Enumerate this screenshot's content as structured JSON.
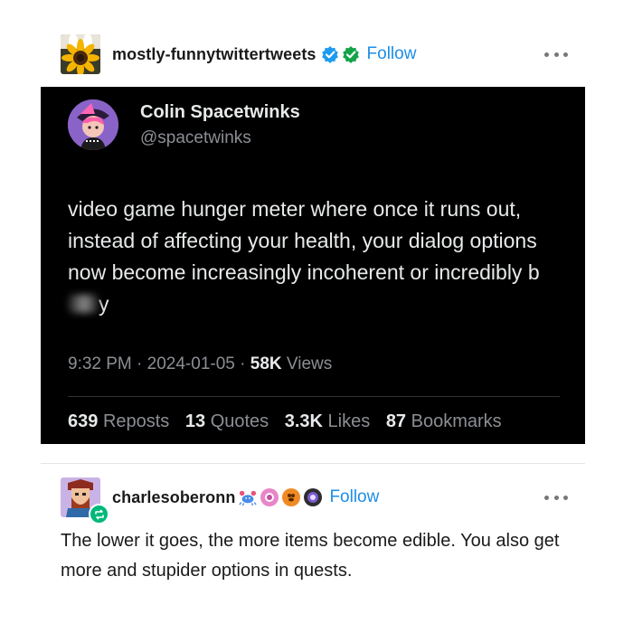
{
  "post1": {
    "username": "mostly-funnytwittertweets",
    "follow_label": "Follow",
    "avatar_icon": "sunflower-avatar-icon",
    "badges": [
      "blue-verified-icon",
      "green-verified-icon"
    ]
  },
  "tweet": {
    "display_name": "Colin Spacetwinks",
    "handle": "@spacetwinks",
    "text_main": "video game hunger meter where once it runs out, instead of affecting your health, your dialog options now become increasingly incoherent or incredibly b",
    "text_tail": "y",
    "time": "9:32 PM",
    "date": "2024-01-05",
    "views_count": "58K",
    "views_label": "Views",
    "reposts_count": "639",
    "reposts_label": "Reposts",
    "quotes_count": "13",
    "quotes_label": "Quotes",
    "likes_count": "3.3K",
    "likes_label": "Likes",
    "bookmarks_count": "87",
    "bookmarks_label": "Bookmarks",
    "separator": " · "
  },
  "post2": {
    "username": "charlesoberonn",
    "follow_label": "Follow",
    "badges": [
      "crab-badge-icon",
      "pink-badge-icon",
      "orange-badge-icon",
      "purple-badge-icon"
    ],
    "reply_text": "The lower it goes, the more items become edible. You also get more and stupider options in quests."
  },
  "colors": {
    "follow": "#1c8ee8",
    "tweet_bg": "#000000",
    "tweet_muted": "#8b8f94"
  }
}
